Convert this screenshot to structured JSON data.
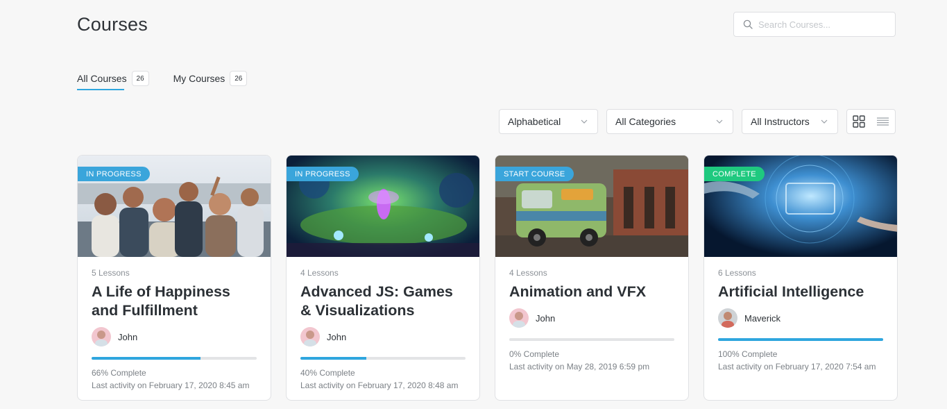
{
  "page": {
    "title": "Courses"
  },
  "search": {
    "placeholder": "Search Courses..."
  },
  "tabs": [
    {
      "label": "All Courses",
      "count": "26"
    },
    {
      "label": "My Courses",
      "count": "26"
    }
  ],
  "filters": {
    "order": "Alphabetical",
    "categories": "All Categories",
    "instructors": "All Instructors"
  },
  "view": {
    "active": "grid"
  },
  "colors": {
    "accent": "#2fa6de",
    "in_progress": "#3aa5db",
    "start_course": "#3aa5db",
    "complete": "#1fc97f"
  },
  "courses": [
    {
      "badge": "IN PROGRESS",
      "lessons": "5 Lessons",
      "title": "A Life of Happiness and Fulfillment",
      "instructor": "John",
      "progress": 0.66,
      "progress_text": "66% Complete",
      "last_activity": "Last activity on February 17, 2020 8:45 am"
    },
    {
      "badge": "IN PROGRESS",
      "lessons": "4 Lessons",
      "title": "Advanced JS: Games & Visualizations",
      "instructor": "John",
      "progress": 0.4,
      "progress_text": "40% Complete",
      "last_activity": "Last activity on February 17, 2020 8:48 am"
    },
    {
      "badge": "START COURSE",
      "lessons": "4 Lessons",
      "title": "Animation and VFX",
      "instructor": "John",
      "progress": 0,
      "progress_text": "0% Complete",
      "last_activity": "Last activity on May 28, 2019 6:59 pm"
    },
    {
      "badge": "COMPLETE",
      "lessons": "6 Lessons",
      "title": "Artificial Intelligence",
      "instructor": "Maverick",
      "progress": 1.0,
      "progress_text": "100% Complete",
      "last_activity": "Last activity on February 17, 2020 7:54 am"
    }
  ]
}
